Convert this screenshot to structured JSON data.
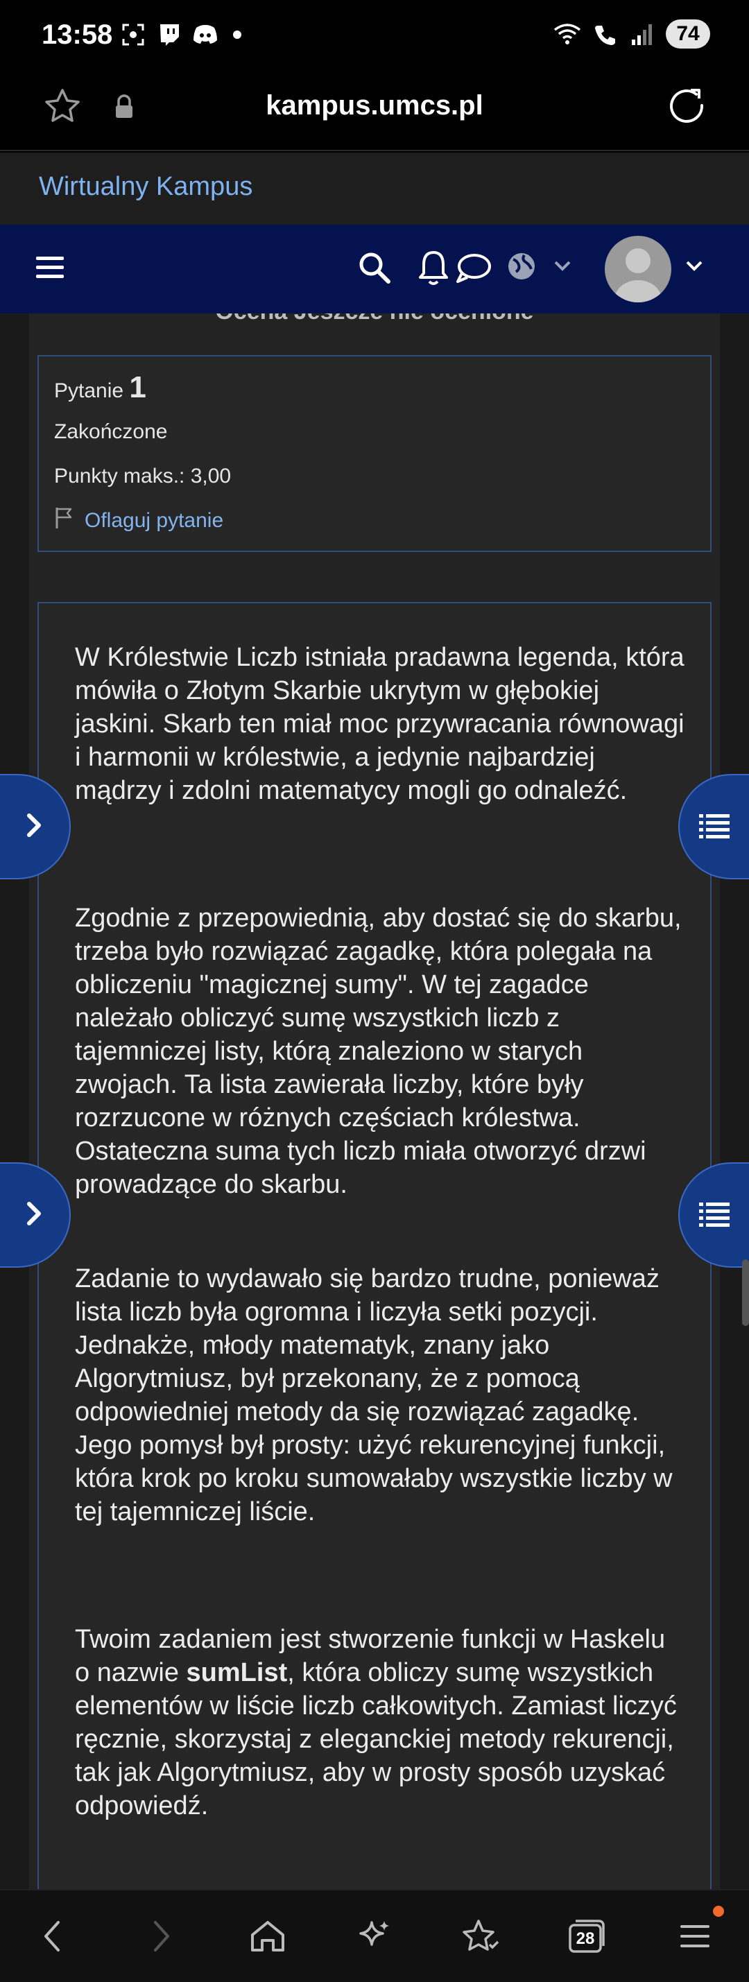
{
  "status_bar": {
    "time": "13:58",
    "battery": "74"
  },
  "browser": {
    "url": "kampus.umcs.pl"
  },
  "site": {
    "brand": "Wirtualny Kampus"
  },
  "quiz": {
    "cutoff_text": "Ocena    Jeszcze nie ocenione",
    "question_label": "Pytanie",
    "question_number": "1",
    "state": "Zakończone",
    "points": "Punkty maks.: 3,00",
    "flag_label": "Oflaguj pytanie"
  },
  "question_text": {
    "p1": "W Królestwie Liczb istniała pradawna legenda, która mówiła o Złotym Skarbie ukrytym w głębokiej jaskini. Skarb ten miał moc przywracania równowagi i harmonii w królestwie, a jedynie najbardziej mądrzy i zdolni matematycy mogli go odnaleźć.",
    "p2": "Zgodnie z przepowiednią, aby dostać się do skarbu, trzeba było rozwiązać zagadkę, która polegała na obliczeniu \"magicznej sumy\". W tej zagadce należało obliczyć sumę wszystkich liczb z tajemniczej listy, którą znaleziono w starych zwojach. Ta lista zawierała liczby, które były rozrzucone w różnych częściach królestwa. Ostateczna suma tych liczb miała otworzyć drzwi prowadzące do skarbu.",
    "p3": "Zadanie to wydawało się bardzo trudne, ponieważ lista liczb była ogromna i liczyła setki pozycji. Jednakże, młody matematyk, znany jako Algorytmiusz, był przekonany, że z pomocą odpowiedniej metody da się rozwiązać zagadkę. Jego pomysł był prosty: użyć rekurencyjnej funkcji, która krok po kroku sumowałaby wszystkie liczby w tej tajemniczej liście.",
    "p4_before": "Twoim zadaniem jest stworzenie funkcji w Haskelu o nazwie ",
    "p4_bold": "sumList",
    "p4_after": ", która obliczy sumę wszystkich elementów w liście liczb całkowitych. Zamiast liczyć ręcznie, skorzystaj z eleganckiej metody rekurencji, tak jak Algorytmiusz, aby w prosty sposób uzyskać odpowiedź."
  },
  "bottom_nav": {
    "tab_count": "28"
  },
  "colors": {
    "navbar": "#051250",
    "link": "#84b4ee",
    "brand": "#7fb2f0",
    "sidetab": "#143a86",
    "notify": "#f06a2c"
  }
}
